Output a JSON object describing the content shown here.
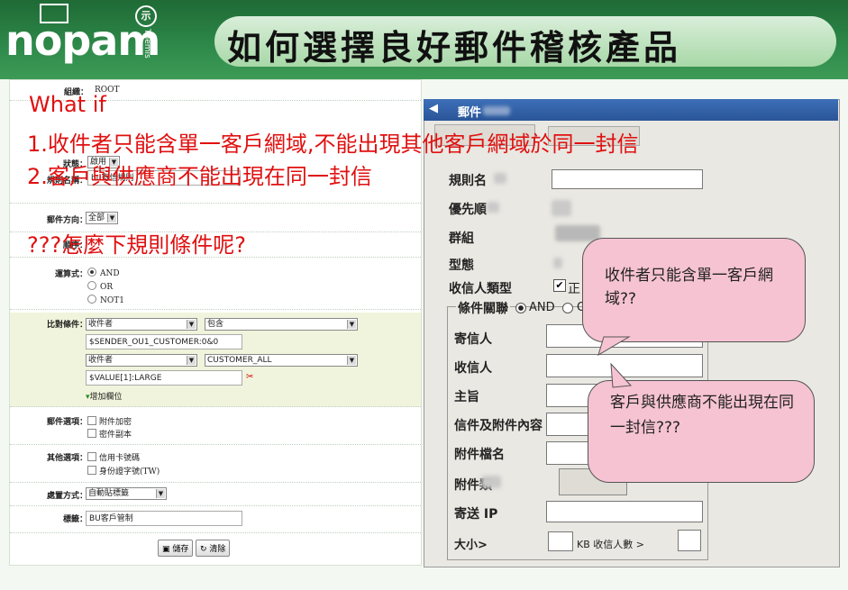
{
  "header": {
    "logo_text": "nopam",
    "logo_badge": "示",
    "logo_sub": "Themis",
    "title": "如何選擇良好郵件稽核產品"
  },
  "left_form": {
    "group_label": "組織：",
    "group_value": "ROOT",
    "status_label": "狀態：",
    "status_value": "啟用",
    "rule_name_label": "規則名稱：",
    "rule_name_value": "bu寄信規則",
    "direction_label": "郵件方向：",
    "direction_value": "全部",
    "order_label": "順序：",
    "operator_label": "運算式：",
    "op_and": "AND",
    "op_or": "OR",
    "op_not": "NOT1",
    "compare_label": "比對條件：",
    "cond1_field": "收件者",
    "cond1_op": "包含",
    "cond1_value": "$SENDER_OU1_CUSTOMER:0&0",
    "cond2_field": "收件者",
    "cond2_op": "CUSTOMER_ALL",
    "cond2_value": "$VALUE[1]:LARGE",
    "add_field": "增加欄位",
    "mail_options_label": "郵件選項：",
    "mail_opt1": "附件加密",
    "mail_opt2": "密件副本",
    "other_options_label": "其他選項：",
    "other_opt1": "信用卡號碼",
    "other_opt2": "身份證字號(TW)",
    "action_label": "處置方式：",
    "action_value": "自動貼標籤",
    "tag_label": "標籤：",
    "tag_value": "BU客戶管制",
    "save_button": "儲存",
    "clear_button": "清除"
  },
  "overlay": {
    "line1": "What if",
    "line2": "1.收件者只能含單一客戶網域,不能出現其他客戶網域於同一封信",
    "line3": "2.客戶與供應商不能出現在同一封信",
    "line4": "???怎麼下規則條件呢?"
  },
  "right_form": {
    "title": "郵件",
    "label_rule_name": "規則名",
    "label_priority": "優先順",
    "label_group": "群組",
    "label_type": "型態",
    "label_recipient_type": "收信人類型",
    "recipient_type_value": "正",
    "fieldset_title": "條件關聯",
    "and_label": "AND",
    "or_label": "OR",
    "label_sender": "寄信人",
    "label_recipient": "收信人",
    "label_subject": "主旨",
    "label_content": "信件及附件內容",
    "label_attach_name": "附件檔名",
    "label_attach_type": "附件類",
    "label_send_ip": "寄送 IP",
    "label_size": "大小>",
    "size_suffix": "KB  收信人數 >"
  },
  "callouts": {
    "c1": "收件者只能含單一客戶網域??",
    "c2": "客戶與供應商不能出現在同一封信???"
  },
  "colors": {
    "header_green": "#2e8a4a",
    "overlay_red": "#e01010",
    "callout_pink": "#f6c3d3"
  }
}
